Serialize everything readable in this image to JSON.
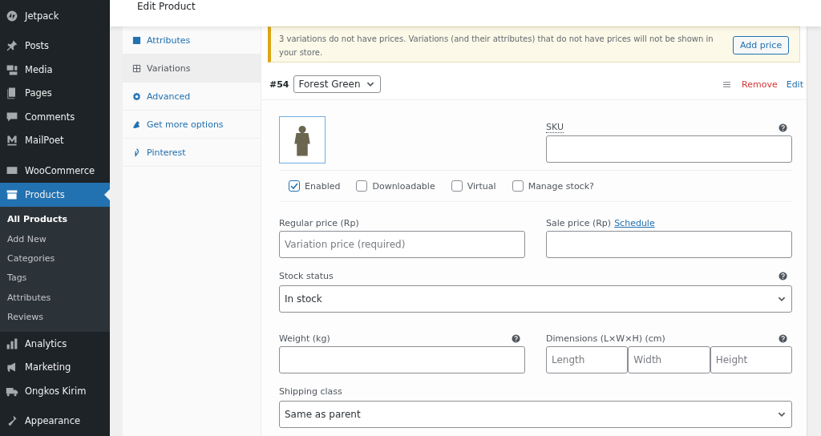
{
  "sidebar": {
    "sections": [
      [
        {
          "label": "Jetpack",
          "selected": false
        }
      ],
      [
        {
          "label": "Posts",
          "selected": false
        },
        {
          "label": "Media",
          "selected": false
        },
        {
          "label": "Pages",
          "selected": false
        },
        {
          "label": "Comments",
          "selected": false
        },
        {
          "label": "MailPoet",
          "selected": false
        }
      ],
      [
        {
          "label": "WooCommerce",
          "selected": false
        },
        {
          "label": "Products",
          "selected": true,
          "children": [
            {
              "label": "All Products",
              "selected": true
            },
            {
              "label": "Add New",
              "selected": false
            },
            {
              "label": "Categories",
              "selected": false
            },
            {
              "label": "Tags",
              "selected": false
            },
            {
              "label": "Attributes",
              "selected": false
            },
            {
              "label": "Reviews",
              "selected": false
            }
          ]
        },
        {
          "label": "Analytics",
          "selected": false
        },
        {
          "label": "Marketing",
          "selected": false
        },
        {
          "label": "Ongkos Kirim",
          "selected": false
        }
      ],
      [
        {
          "label": "Appearance",
          "selected": false
        }
      ]
    ]
  },
  "header": {
    "title": "Edit Product"
  },
  "product_tabs": [
    {
      "label": "Attributes",
      "selected": false
    },
    {
      "label": "Variations",
      "selected": true
    },
    {
      "label": "Advanced",
      "selected": false
    },
    {
      "label": "Get more options",
      "selected": false
    },
    {
      "label": "Pinterest",
      "selected": false
    }
  ],
  "notice": {
    "text": "3 variations do not have prices. Variations (and their attributes) that do not have prices will not be shown in your store.",
    "button": "Add price"
  },
  "variation": {
    "number": "#54",
    "attribute": "Forest Green",
    "remove": "Remove",
    "edit": "Edit",
    "sku": {
      "label": "SKU"
    },
    "options": [
      {
        "label": "Enabled",
        "checked": true
      },
      {
        "label": "Downloadable",
        "checked": false
      },
      {
        "label": "Virtual",
        "checked": false
      },
      {
        "label": "Manage stock?",
        "checked": false
      }
    ],
    "regular_price": {
      "label": "Regular price (Rp)",
      "placeholder": "Variation price (required)"
    },
    "sale_price": {
      "label": "Sale price (Rp)",
      "link": "Schedule"
    },
    "stock_status": {
      "label": "Stock status",
      "value": "In stock"
    },
    "weight": {
      "label": "Weight (kg)"
    },
    "dimensions": {
      "label": "Dimensions (L×W×H) (cm)",
      "placeholders": [
        "Length",
        "Width",
        "Height"
      ]
    },
    "shipping_class": {
      "label": "Shipping class",
      "value": "Same as parent"
    }
  }
}
